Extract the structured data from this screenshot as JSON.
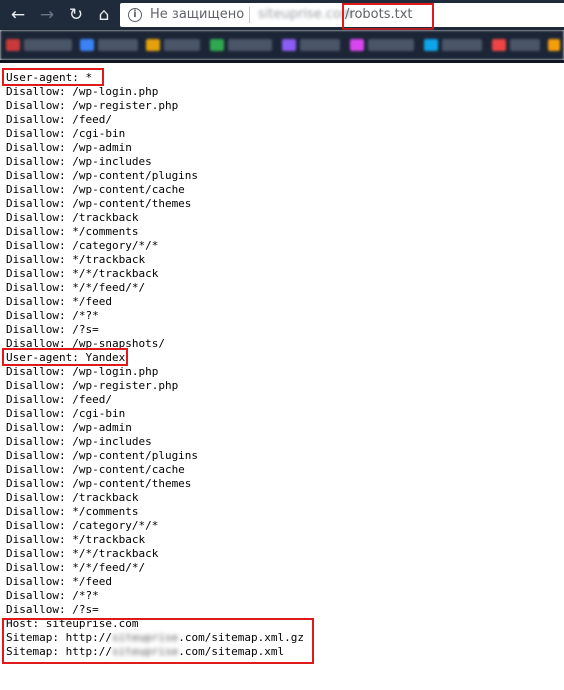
{
  "browser": {
    "security_label": "Не защищено",
    "url_domain": "siteuprise.com",
    "url_path": "/robots.txt"
  },
  "robots": {
    "lines": [
      "User-agent: *",
      "Disallow: /wp-login.php",
      "Disallow: /wp-register.php",
      "Disallow: /feed/",
      "Disallow: /cgi-bin",
      "Disallow: /wp-admin",
      "Disallow: /wp-includes",
      "Disallow: /wp-content/plugins",
      "Disallow: /wp-content/cache",
      "Disallow: /wp-content/themes",
      "Disallow: /trackback",
      "Disallow: */comments",
      "Disallow: /category/*/*",
      "Disallow: */trackback",
      "Disallow: */*/trackback",
      "Disallow: */*/feed/*/",
      "Disallow: */feed",
      "Disallow: /*?*",
      "Disallow: /?s=",
      "Disallow: /wp-snapshots/",
      "User-agent: Yandex",
      "Disallow: /wp-login.php",
      "Disallow: /wp-register.php",
      "Disallow: /feed/",
      "Disallow: /cgi-bin",
      "Disallow: /wp-admin",
      "Disallow: /wp-includes",
      "Disallow: /wp-content/plugins",
      "Disallow: /wp-content/cache",
      "Disallow: /wp-content/themes",
      "Disallow: /trackback",
      "Disallow: */comments",
      "Disallow: /category/*/*",
      "Disallow: */trackback",
      "Disallow: */*/trackback",
      "Disallow: */*/feed/*/",
      "Disallow: */feed",
      "Disallow: /*?*",
      "Disallow: /?s=",
      "Host: siteuprise.com"
    ],
    "sitemap_lines": [
      {
        "prefix": "Sitemap: http://",
        "hidden": "siteuprise",
        "suffix": ".com/sitemap.xml.gz"
      },
      {
        "prefix": "Sitemap: http://",
        "hidden": "siteuprise",
        "suffix": ".com/sitemap.xml"
      }
    ]
  },
  "colors": {
    "highlight": "#e0191c",
    "chrome_dark": "#1f2a3a"
  },
  "icons": {
    "back": "arrow-left",
    "forward": "arrow-right",
    "reload": "reload",
    "home": "home",
    "security": "info-circle"
  }
}
